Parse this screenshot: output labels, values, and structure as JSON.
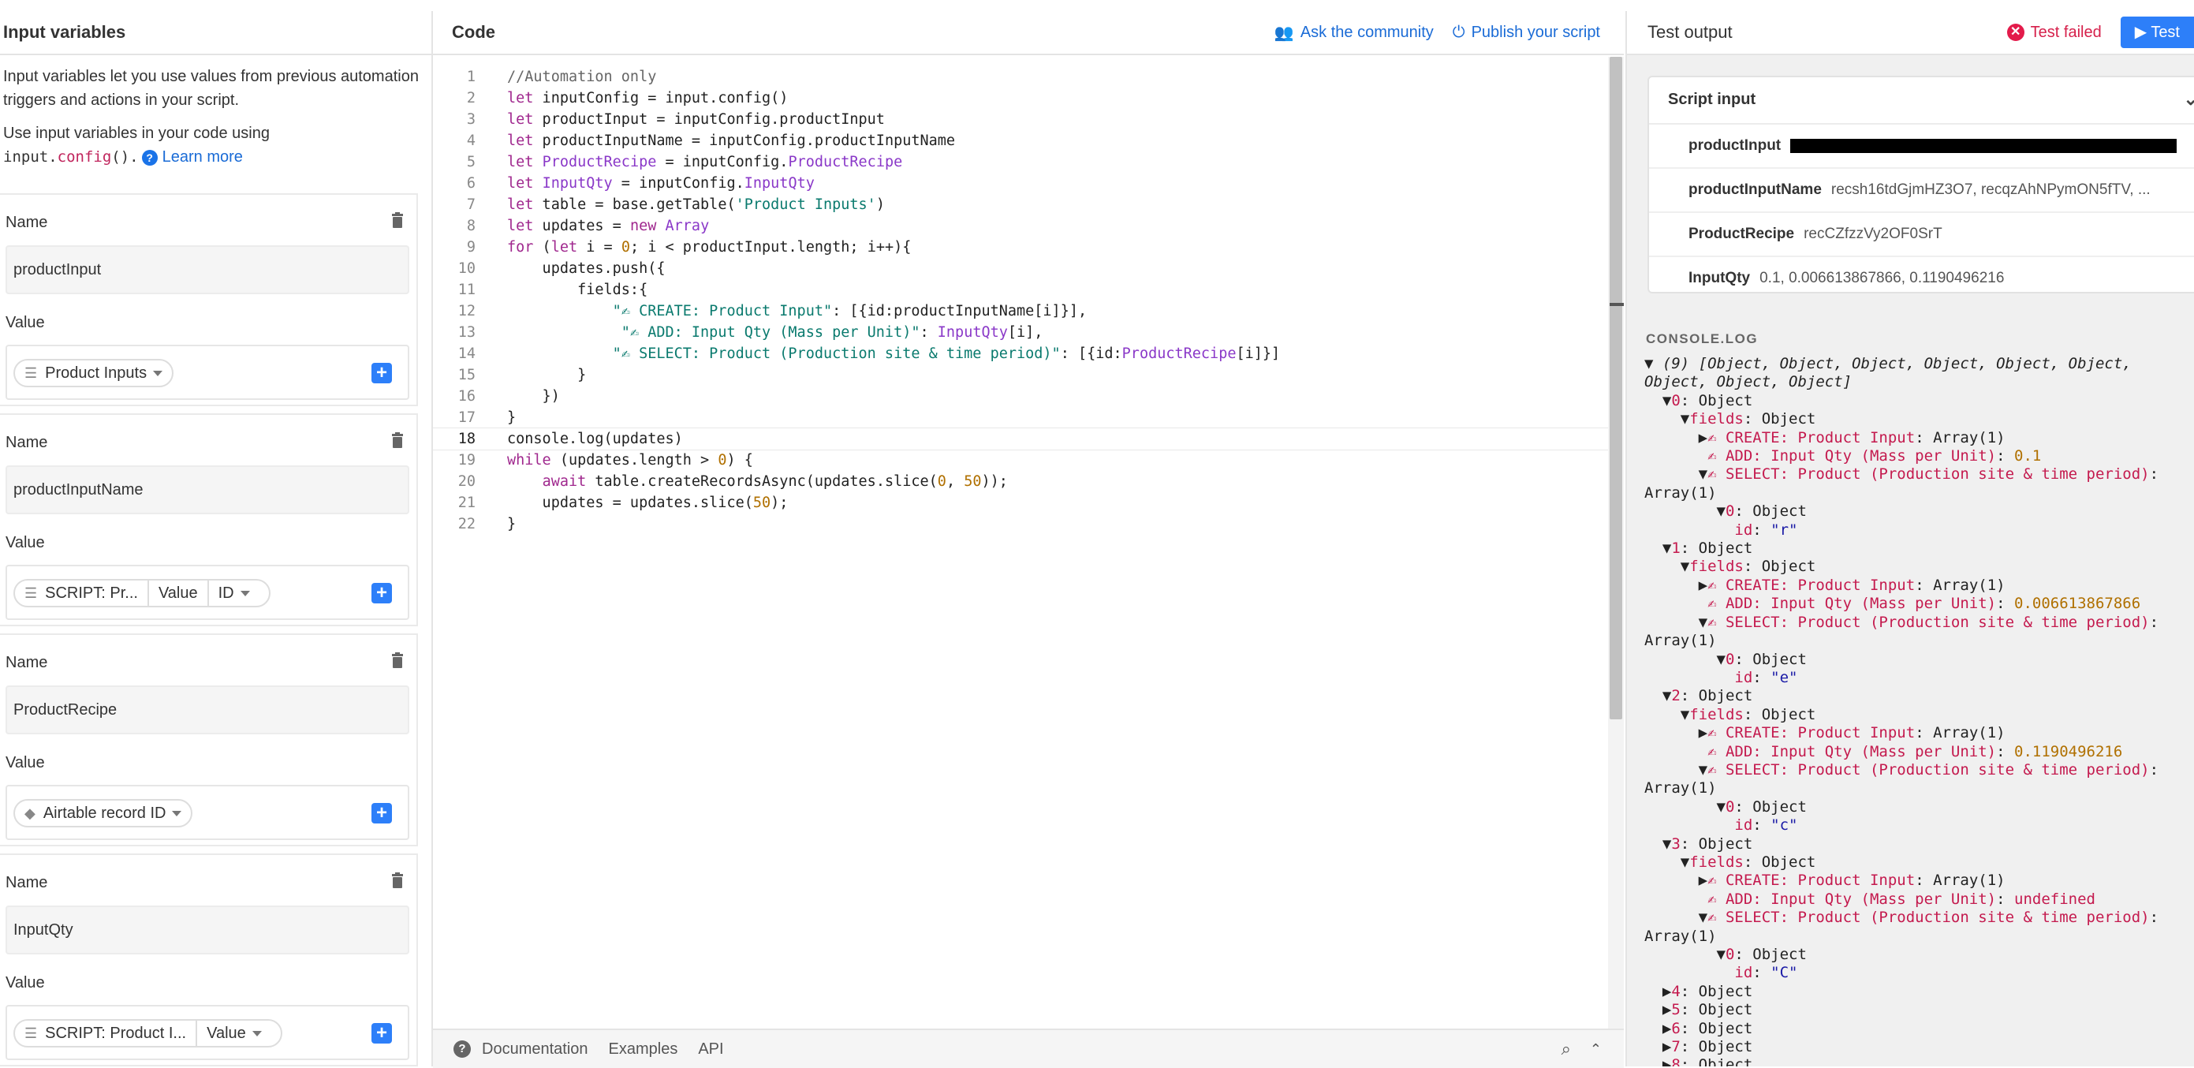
{
  "left": {
    "title": "Input variables",
    "intro1": "Input variables let you use values from previous automation triggers and actions in your script.",
    "intro2": "Use input variables in your code using",
    "intro_code_a": "input.",
    "intro_code_b": "config",
    "intro_code_c": "().",
    "learn_more": "Learn more",
    "name_label": "Name",
    "value_label": "Value",
    "variables": [
      {
        "name": "productInput",
        "pills": [
          "Product Inputs"
        ]
      },
      {
        "name": "productInputName",
        "pills": [
          "SCRIPT: Pr...",
          "Value",
          "ID"
        ]
      },
      {
        "name": "ProductRecipe",
        "pills": [
          "Airtable record ID"
        ]
      },
      {
        "name": "InputQty",
        "pills": [
          "SCRIPT: Product I...",
          "Value"
        ]
      }
    ]
  },
  "code": {
    "title": "Code",
    "ask_community": "Ask the community",
    "publish": "Publish your script",
    "active_line": 18,
    "footer": {
      "documentation": "Documentation",
      "examples": "Examples",
      "api": "API"
    }
  },
  "test": {
    "title": "Test output",
    "status": "Test failed",
    "test_button": "Test",
    "script_input_title": "Script input",
    "rows": [
      {
        "key": "productInput",
        "value": ""
      },
      {
        "key": "productInputName",
        "value": "recsh16tdGjmHZ3O7, recqzAhNPymON5fTV, ..."
      },
      {
        "key": "ProductRecipe",
        "value": "recCZfzzVy2OF0SrT"
      },
      {
        "key": "InputQty",
        "value": "0.1, 0.006613867866, 0.1190496216"
      }
    ],
    "console_label": "CONSOLE.LOG"
  }
}
